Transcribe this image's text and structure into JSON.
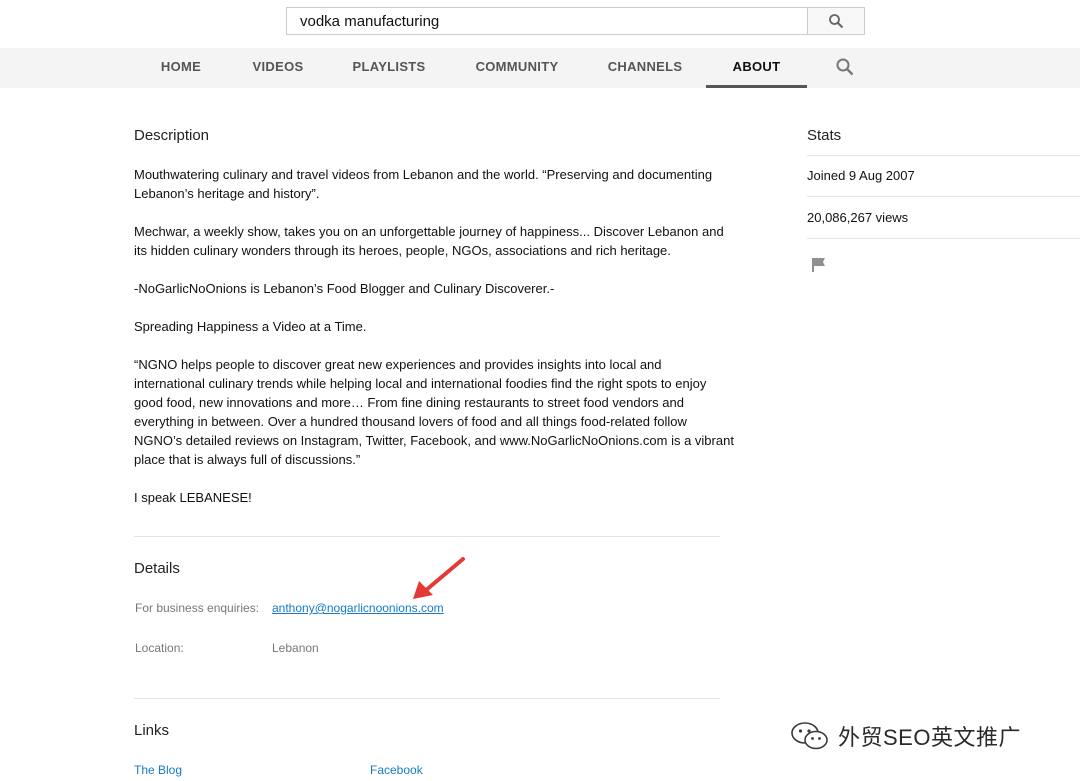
{
  "search": {
    "query": "vodka manufacturing"
  },
  "tabs": [
    {
      "label": "HOME",
      "active": false
    },
    {
      "label": "VIDEOS",
      "active": false
    },
    {
      "label": "PLAYLISTS",
      "active": false
    },
    {
      "label": "COMMUNITY",
      "active": false
    },
    {
      "label": "CHANNELS",
      "active": false
    },
    {
      "label": "ABOUT",
      "active": true
    }
  ],
  "description": {
    "title": "Description",
    "paragraphs": [
      "Mouthwatering culinary and travel videos from Lebanon and the world. “Preserving and documenting Lebanon’s heritage and history”.",
      "Mechwar, a weekly show, takes you on an unforgettable journey of happiness... Discover Lebanon and its hidden culinary wonders through its heroes, people, NGOs, associations and rich heritage.",
      "-NoGarlicNoOnions is Lebanon’s Food Blogger and Culinary Discoverer.-",
      "Spreading Happiness a Video at a Time.",
      "“NGNO helps people to discover great new experiences and provides insights into local and international culinary trends while helping local and international foodies find the right spots to enjoy good food, new innovations and more… From fine dining restaurants to street food vendors and everything in between. Over a hundred thousand lovers of food and all things food-related follow NGNO’s detailed reviews on Instagram, Twitter, Facebook, and www.NoGarlicNoOnions.com is a vibrant place that is always full of discussions.”",
      "I speak LEBANESE!"
    ]
  },
  "details": {
    "title": "Details",
    "business_label": "For business enquiries:",
    "business_email": "anthony@nogarlicnoonions.com",
    "location_label": "Location:",
    "location_value": "Lebanon"
  },
  "links": {
    "title": "Links",
    "items": [
      "The Blog",
      "Facebook"
    ]
  },
  "stats": {
    "title": "Stats",
    "joined": "Joined 9 Aug 2007",
    "views": "20,086,267 views"
  },
  "watermark": {
    "text": "外贸SEO英文推广"
  },
  "colors": {
    "link": "#167ac6",
    "annotation_arrow": "#e53935"
  }
}
